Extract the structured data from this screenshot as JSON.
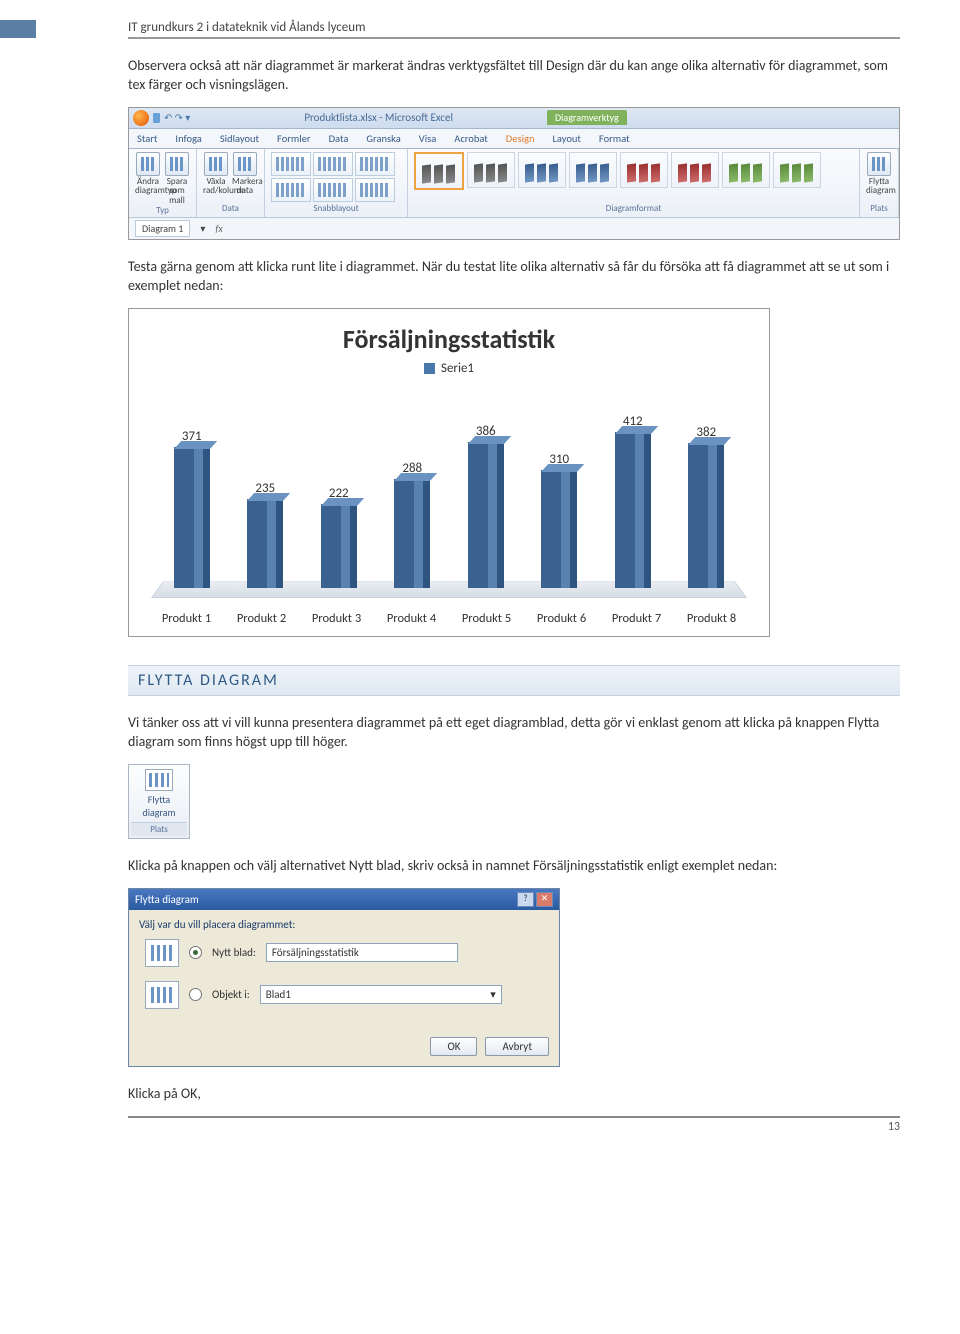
{
  "header": "IT grundkurs 2 i datateknik vid Ålands lyceum",
  "para1": "Observera också att när diagrammet är markerat ändras verktygsfältet till Design där du kan ange olika alternativ för diagrammet, som tex färger och visningslägen.",
  "ribbon": {
    "title": "Produktlista.xlsx - Microsoft Excel",
    "ctx": "Diagramverktyg",
    "tabs": [
      "Start",
      "Infoga",
      "Sidlayout",
      "Formler",
      "Data",
      "Granska",
      "Visa",
      "Acrobat",
      "Design",
      "Layout",
      "Format"
    ],
    "grp_typ": "Typ",
    "grp_data": "Data",
    "grp_snabb": "Snabblayout",
    "grp_format": "Diagramformat",
    "grp_plats": "Plats",
    "btn_andra": "Ändra diagramtyp",
    "btn_spara": "Spara som mall",
    "btn_vaxla": "Växla rad/kolumn",
    "btn_markera": "Markera data",
    "btn_flytta": "Flytta diagram",
    "namebox": "Diagram 1"
  },
  "para2": "Testa gärna genom att klicka runt lite i diagrammet. När du testat lite olika alternativ så får du försöka att få diagrammet att se ut som i exemplet nedan:",
  "chart_data": {
    "type": "bar",
    "title": "Försäljningsstatistik",
    "legend": "Serie1",
    "categories": [
      "Produkt 1",
      "Produkt 2",
      "Produkt 3",
      "Produkt 4",
      "Produkt 5",
      "Produkt 6",
      "Produkt 7",
      "Produkt 8"
    ],
    "values": [
      371,
      235,
      222,
      288,
      386,
      310,
      412,
      382
    ],
    "ylim": [
      0,
      450
    ]
  },
  "section1": "FLYTTA DIAGRAM",
  "para3": "Vi tänker oss att vi vill kunna presentera diagrammet på ett eget diagramblad, detta gör vi enklast genom att klicka på knappen Flytta diagram som finns högst upp till höger.",
  "flytta_btn": {
    "l1": "Flytta",
    "l2": "diagram",
    "grp": "Plats"
  },
  "para4": "Klicka på knappen och välj alternativet Nytt blad, skriv också in namnet Försäljningsstatistik enligt exemplet nedan:",
  "dialog": {
    "title": "Flytta diagram",
    "prompt": "Välj var du vill placera diagrammet:",
    "opt1": "Nytt blad:",
    "opt1_val": "Försäljningsstatistik",
    "opt2": "Objekt i:",
    "opt2_val": "Blad1",
    "ok": "OK",
    "cancel": "Avbryt"
  },
  "para5": "Klicka på OK,",
  "page_num": "13"
}
